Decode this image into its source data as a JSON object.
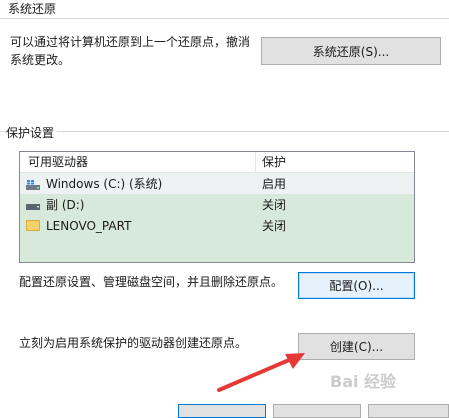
{
  "restore": {
    "section_title": "系统还原",
    "description_line1": "可以通过将计算机还原到上一个还原点，撤消",
    "description_line2": "系统更改。",
    "restore_button": "系统还原(S)..."
  },
  "protection": {
    "section_title": "保护设置",
    "headers": {
      "drive": "可用驱动器",
      "protection": "保护"
    },
    "drives": [
      {
        "name": "Windows (C:) (系统)",
        "status": "启用",
        "icon": "windows-drive-icon"
      },
      {
        "name": "副 (D:)",
        "status": "关闭",
        "icon": "drive-icon"
      },
      {
        "name": "LENOVO_PART",
        "status": "关闭",
        "icon": "folder-icon"
      }
    ],
    "configure_text": "配置还原设置、管理磁盘空间，并且删除还原点。",
    "configure_button": "配置(O)...",
    "create_text": "立刻为启用系统保护的驱动器创建还原点。",
    "create_button": "创建(C)..."
  },
  "colors": {
    "highlight": "#d7e9da",
    "arrow": "#e53935",
    "focus_border": "#0078d7"
  },
  "watermark": "Bai 经验"
}
